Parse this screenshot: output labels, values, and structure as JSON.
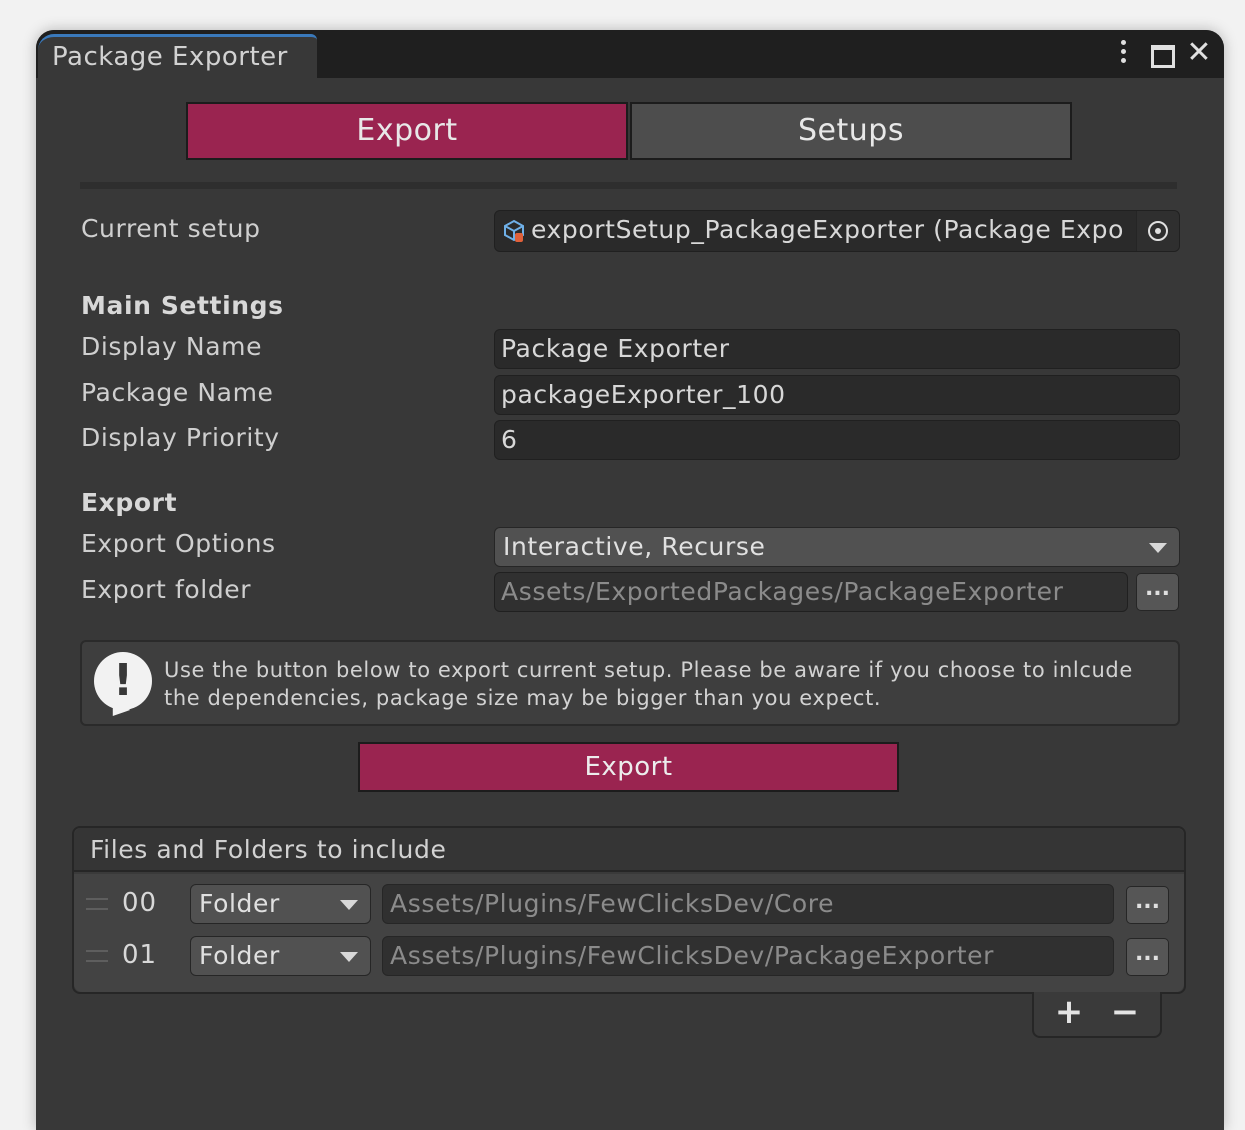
{
  "window": {
    "title": "Package Exporter"
  },
  "tabs": [
    {
      "label": "Export",
      "active": true
    },
    {
      "label": "Setups",
      "active": false
    }
  ],
  "current_setup": {
    "label": "Current setup",
    "value": "exportSetup_PackageExporter (Package Expo"
  },
  "main_settings": {
    "heading": "Main Settings",
    "display_name_label": "Display Name",
    "display_name_value": "Package Exporter",
    "package_name_label": "Package Name",
    "package_name_value": "packageExporter_100",
    "display_priority_label": "Display Priority",
    "display_priority_value": "6"
  },
  "export_section": {
    "heading": "Export",
    "options_label": "Export Options",
    "options_value": "Interactive, Recurse",
    "folder_label": "Export folder",
    "folder_value": "Assets/ExportedPackages/PackageExporter",
    "browse_label": "..."
  },
  "help": {
    "line1": "Use the button below to export current setup. Please be aware if you choose to inlcude",
    "line2": "the dependencies, package size may be bigger than you expect."
  },
  "export_button": "Export",
  "files": {
    "header": "Files and Folders to include",
    "rows": [
      {
        "index": "00",
        "type": "Folder",
        "path": "Assets/Plugins/FewClicksDev/Core",
        "browse": "..."
      },
      {
        "index": "01",
        "type": "Folder",
        "path": "Assets/Plugins/FewClicksDev/PackageExporter",
        "browse": "..."
      }
    ],
    "add_label": "+",
    "remove_label": "−"
  },
  "colors": {
    "accent": "#9a2450",
    "background": "#383838",
    "titlebar": "#1f1f1f"
  }
}
